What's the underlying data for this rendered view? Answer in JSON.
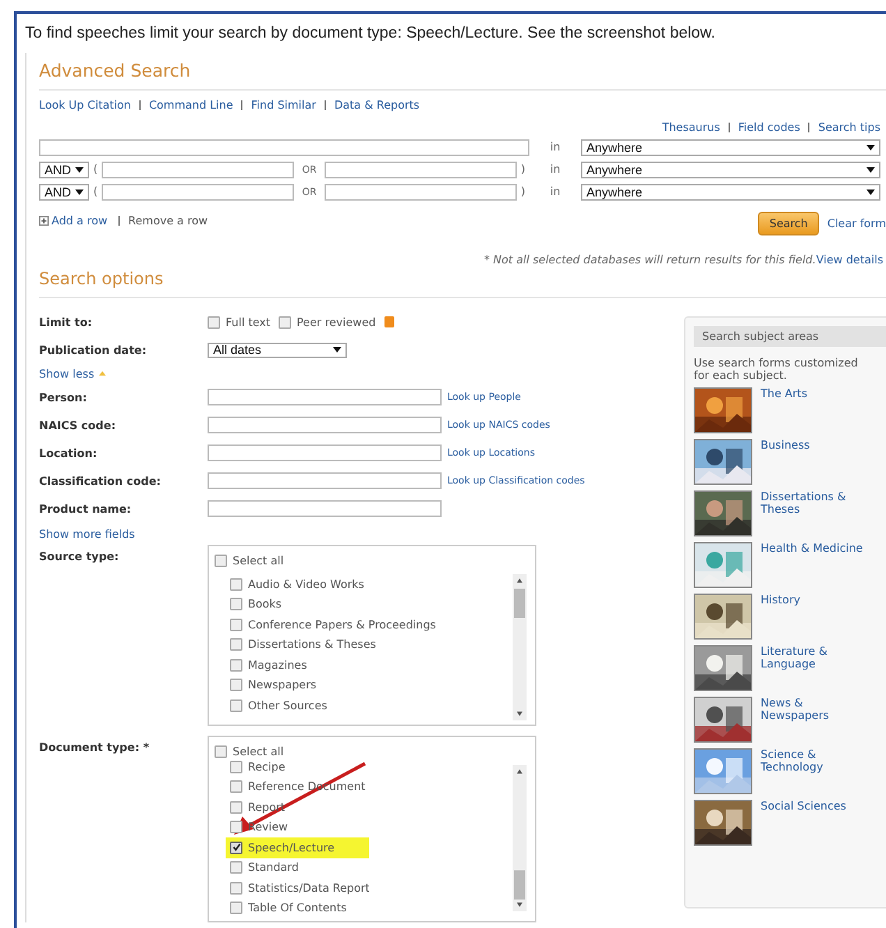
{
  "intro": "To find speeches limit your search by document type: Speech/Lecture. See the screenshot below.",
  "title": "Advanced Search",
  "top_links": [
    "Look Up Citation",
    "Command Line",
    "Find Similar",
    "Data & Reports"
  ],
  "tool_links": [
    "Thesaurus",
    "Field codes",
    "Search tips"
  ],
  "search_rows": [
    {
      "kind": "single",
      "in_label": "in",
      "scope": "Anywhere"
    },
    {
      "kind": "pair",
      "operator": "AND",
      "open": "(",
      "or_label": "OR",
      "close": ")",
      "in_label": "in",
      "scope": "Anywhere"
    },
    {
      "kind": "pair",
      "operator": "AND",
      "open": "(",
      "or_label": "OR",
      "close": ")",
      "in_label": "in",
      "scope": "Anywhere"
    }
  ],
  "row_links": [
    "Add a row",
    "Remove a row"
  ],
  "search_button": "Search",
  "clear_link": "Clear form",
  "note": "* Not all selected databases will return results for this field.",
  "note_link": "View details",
  "options_title": "Search options",
  "limit": {
    "label": "Limit to:",
    "options": [
      {
        "label": "Full text",
        "checked": false
      },
      {
        "label": "Peer reviewed",
        "checked": false
      }
    ]
  },
  "publication_date": {
    "label": "Publication date:",
    "value": "All dates"
  },
  "show_less": "Show less",
  "fields": [
    {
      "label": "Person:",
      "link": "Look up People"
    },
    {
      "label": "NAICS code:",
      "link": "Look up NAICS codes"
    },
    {
      "label": "Location:",
      "link": "Look up Locations"
    },
    {
      "label": "Classification code:",
      "link": "Look up Classification codes"
    },
    {
      "label": "Product name:"
    }
  ],
  "show_more": "Show more fields",
  "source_type": {
    "label": "Source type:",
    "select_all": {
      "label": "Select all",
      "checked": false
    },
    "scrolled": false,
    "items": [
      {
        "label": "Audio & Video Works",
        "checked": false,
        "highlighted": false
      },
      {
        "label": "Books",
        "checked": false,
        "highlighted": false
      },
      {
        "label": "Conference Papers & Proceedings",
        "checked": false,
        "highlighted": false
      },
      {
        "label": "Dissertations & Theses",
        "checked": false,
        "highlighted": false
      },
      {
        "label": "Magazines",
        "checked": false,
        "highlighted": false
      },
      {
        "label": "Newspapers",
        "checked": false,
        "highlighted": false
      },
      {
        "label": "Other Sources",
        "checked": false,
        "highlighted": false
      }
    ]
  },
  "document_type": {
    "label": "Document type: *",
    "select_all": {
      "label": "Select all",
      "checked": false
    },
    "scrolled": true,
    "items": [
      {
        "label": "Recipe",
        "checked": false,
        "highlighted": false
      },
      {
        "label": "Reference Document",
        "checked": false,
        "highlighted": false
      },
      {
        "label": "Report",
        "checked": false,
        "highlighted": false
      },
      {
        "label": "Review",
        "checked": false,
        "highlighted": false
      },
      {
        "label": "Speech/Lecture",
        "checked": true,
        "highlighted": true
      },
      {
        "label": "Standard",
        "checked": false,
        "highlighted": false
      },
      {
        "label": "Statistics/Data Report",
        "checked": false,
        "highlighted": false
      },
      {
        "label": "Table Of Contents",
        "checked": false,
        "highlighted": false
      }
    ]
  },
  "subjects": {
    "title": "Search subject areas",
    "intro": "Use search forms customized for each subject.",
    "items": [
      "The Arts",
      "Business",
      "Dissertations & Theses",
      "Health & Medicine",
      "History",
      "Literature & Language",
      "News & Newspapers",
      "Science & Technology",
      "Social Sciences"
    ]
  }
}
